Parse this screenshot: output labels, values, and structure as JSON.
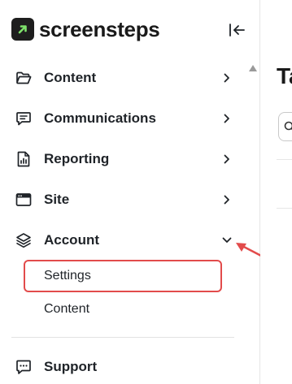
{
  "brand": {
    "name": "screensteps"
  },
  "sidebar": {
    "items": [
      {
        "label": "Content",
        "icon": "folder-icon",
        "chevron": "right"
      },
      {
        "label": "Communications",
        "icon": "message-icon",
        "chevron": "right"
      },
      {
        "label": "Reporting",
        "icon": "report-icon",
        "chevron": "right"
      },
      {
        "label": "Site",
        "icon": "browser-icon",
        "chevron": "right"
      },
      {
        "label": "Account",
        "icon": "layers-icon",
        "chevron": "down"
      }
    ],
    "account_subitems": [
      {
        "label": "Settings",
        "highlighted": true
      },
      {
        "label": "Content",
        "highlighted": false
      }
    ],
    "footer_item": {
      "label": "Support",
      "icon": "chat-dots-icon"
    }
  },
  "main": {
    "title_partial": "Ta"
  },
  "colors": {
    "highlight": "#e24b4b",
    "logo_bg": "#1e1e1e",
    "logo_accent": "#7ee26b"
  }
}
